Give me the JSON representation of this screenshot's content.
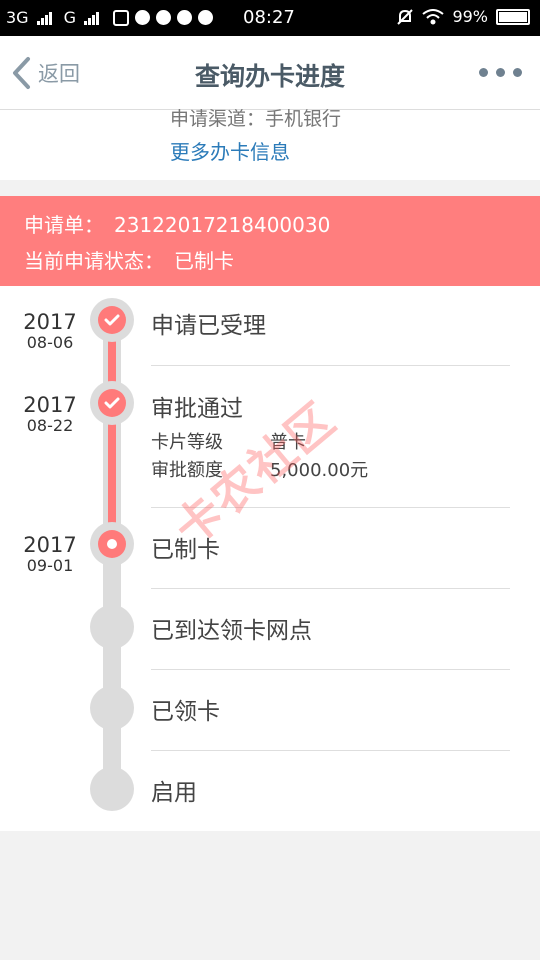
{
  "status_bar": {
    "network1": "3G",
    "network2": "G",
    "time": "08:27",
    "battery": "99%",
    "icons": [
      "signal-icon",
      "sim-icon",
      "notification-icon",
      "settings-icon",
      "shield-icon",
      "mute-icon",
      "wifi-icon",
      "battery-icon"
    ]
  },
  "nav": {
    "back_label": "返回",
    "title": "查询办卡进度"
  },
  "info": {
    "channel": "申请渠道：手机银行",
    "more_info": "更多办卡信息"
  },
  "banner": {
    "order_label": "申请单：",
    "order_no": "23122017218400030",
    "status_label": "当前申请状态：",
    "status_value": "已制卡"
  },
  "timeline": {
    "steps": [
      {
        "year": "2017",
        "date": "08-06",
        "title": "申请已受理",
        "state": "done"
      },
      {
        "year": "2017",
        "date": "08-22",
        "title": "审批通过",
        "state": "done",
        "details": [
          {
            "label": "卡片等级",
            "value": "普卡"
          },
          {
            "label": "审批额度",
            "value": "5,000.00元"
          }
        ]
      },
      {
        "year": "2017",
        "date": "09-01",
        "title": "已制卡",
        "state": "current"
      },
      {
        "year": "",
        "date": "",
        "title": "已到达领卡网点",
        "state": "pending"
      },
      {
        "year": "",
        "date": "",
        "title": "已领卡",
        "state": "pending"
      },
      {
        "year": "",
        "date": "",
        "title": "启用",
        "state": "pending"
      }
    ]
  },
  "watermark": "卡农社区",
  "colors": {
    "accent_red": "#ff7e7e",
    "track_gray": "#dcdcdc",
    "link_blue": "#2b7bb9"
  }
}
